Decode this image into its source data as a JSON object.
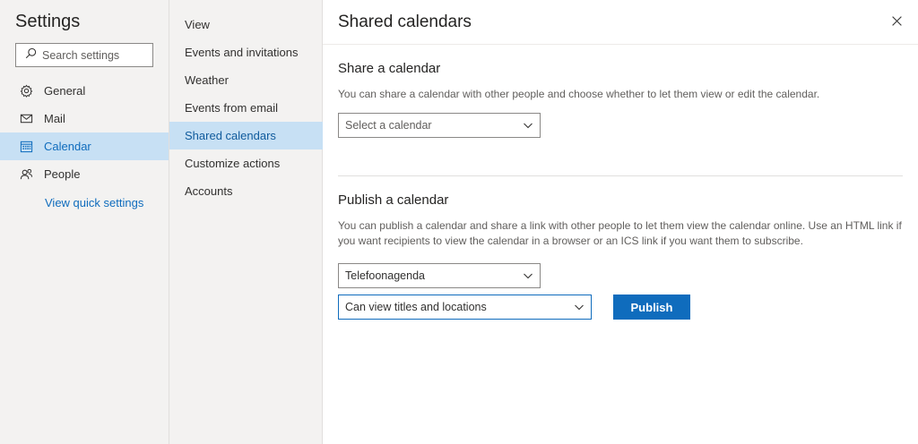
{
  "settings": {
    "title": "Settings",
    "search_placeholder": "Search settings",
    "nav": [
      {
        "label": "General",
        "icon": "gear-icon"
      },
      {
        "label": "Mail",
        "icon": "mail-icon"
      },
      {
        "label": "Calendar",
        "icon": "calendar-icon",
        "selected": true
      },
      {
        "label": "People",
        "icon": "people-icon"
      }
    ],
    "quick_settings_link": "View quick settings"
  },
  "calendar_menu": {
    "items": [
      {
        "label": "View"
      },
      {
        "label": "Events and invitations"
      },
      {
        "label": "Weather"
      },
      {
        "label": "Events from email"
      },
      {
        "label": "Shared calendars",
        "selected": true
      },
      {
        "label": "Customize actions"
      },
      {
        "label": "Accounts"
      }
    ]
  },
  "pane": {
    "title": "Shared calendars",
    "share": {
      "heading": "Share a calendar",
      "description": "You can share a calendar with other people and choose whether to let them view or edit the calendar.",
      "select_value": "Select a calendar"
    },
    "publish": {
      "heading": "Publish a calendar",
      "description": "You can publish a calendar and share a link with other people to let them view the calendar online. Use an HTML link if you want recipients to view the calendar in a browser or an ICS link if you want them to subscribe.",
      "calendar_value": "Telefoonagenda",
      "permission_value": "Can view titles and locations",
      "button_label": "Publish"
    }
  },
  "colors": {
    "accent": "#0f6cbd",
    "selected_bg": "#c7e0f4",
    "sidebar_bg": "#f3f2f1"
  }
}
